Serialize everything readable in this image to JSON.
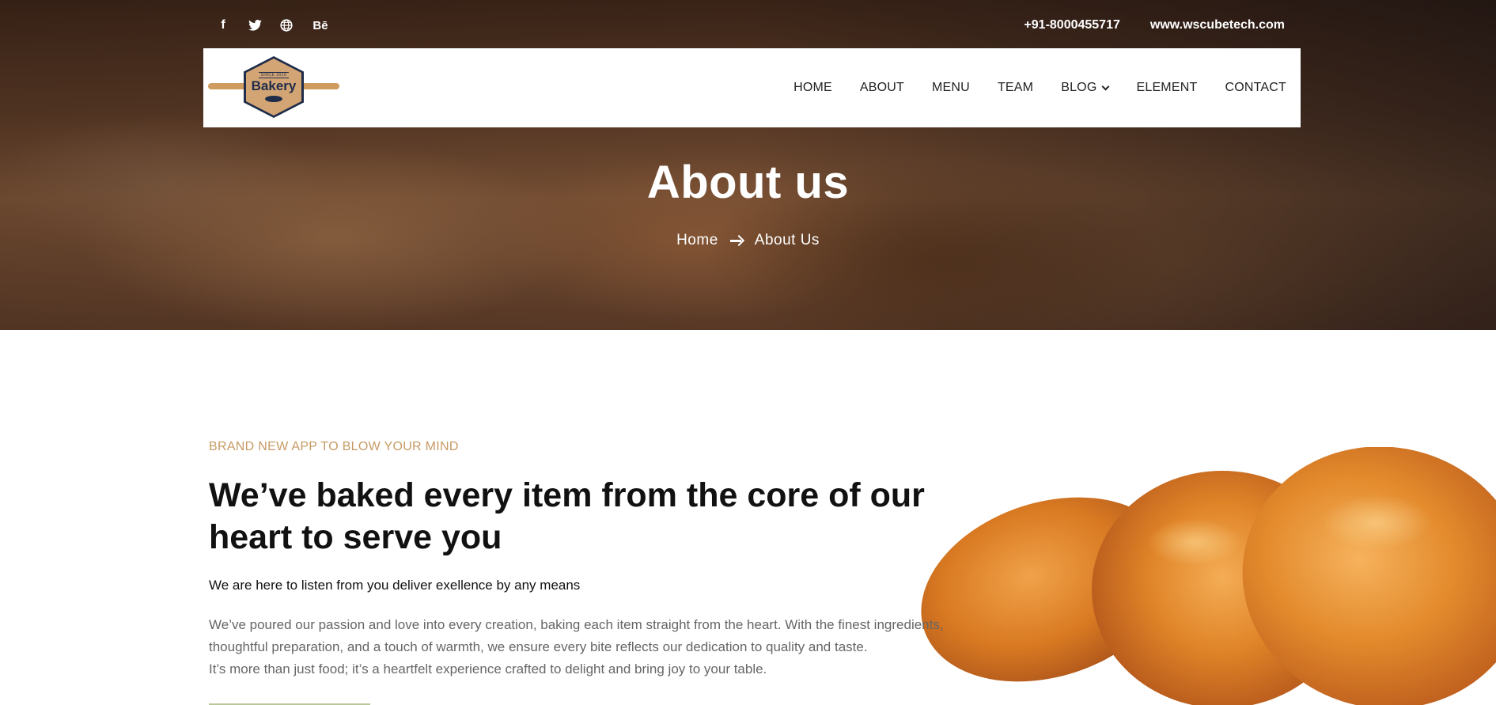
{
  "topbar": {
    "social_icons": [
      {
        "name": "facebook-icon",
        "glyph": "f"
      },
      {
        "name": "twitter-icon",
        "glyph": "🐦"
      },
      {
        "name": "globe-icon",
        "glyph": "🌐"
      },
      {
        "name": "behance-icon",
        "glyph": "Bē"
      }
    ],
    "phone": "+91-8000455717",
    "website": "www.wscubetech.com"
  },
  "logo": {
    "since_text": "SINCE 2016",
    "word": "Bakery"
  },
  "nav": {
    "items": [
      "HOME",
      "ABOUT",
      "MENU",
      "TEAM",
      "BLOG",
      "ELEMENT",
      "CONTACT"
    ]
  },
  "hero": {
    "title": "About us",
    "breadcrumb_home": "Home",
    "breadcrumb_current": "About Us"
  },
  "about": {
    "eyebrow": "BRAND NEW APP TO BLOW YOUR MIND",
    "headline_line1": "We’ve baked every item from the core of our",
    "headline_line2": "heart to serve you",
    "subtitle": "We are here to listen from you deliver exellence by any means",
    "body_line1": "We’ve poured our passion and love into every creation, baking each item straight from the heart. With the finest ingredients,",
    "body_line2": "thoughtful preparation, and a touch of warmth, we ensure every bite reflects our dedication to quality and taste.",
    "body_line3": "It’s more than just food; it’s a heartfelt experience crafted to delight and bring joy to your table."
  },
  "colors": {
    "accent": "#c79a64",
    "logo_navy": "#1f2d4a",
    "logo_tan": "#d4a574"
  }
}
